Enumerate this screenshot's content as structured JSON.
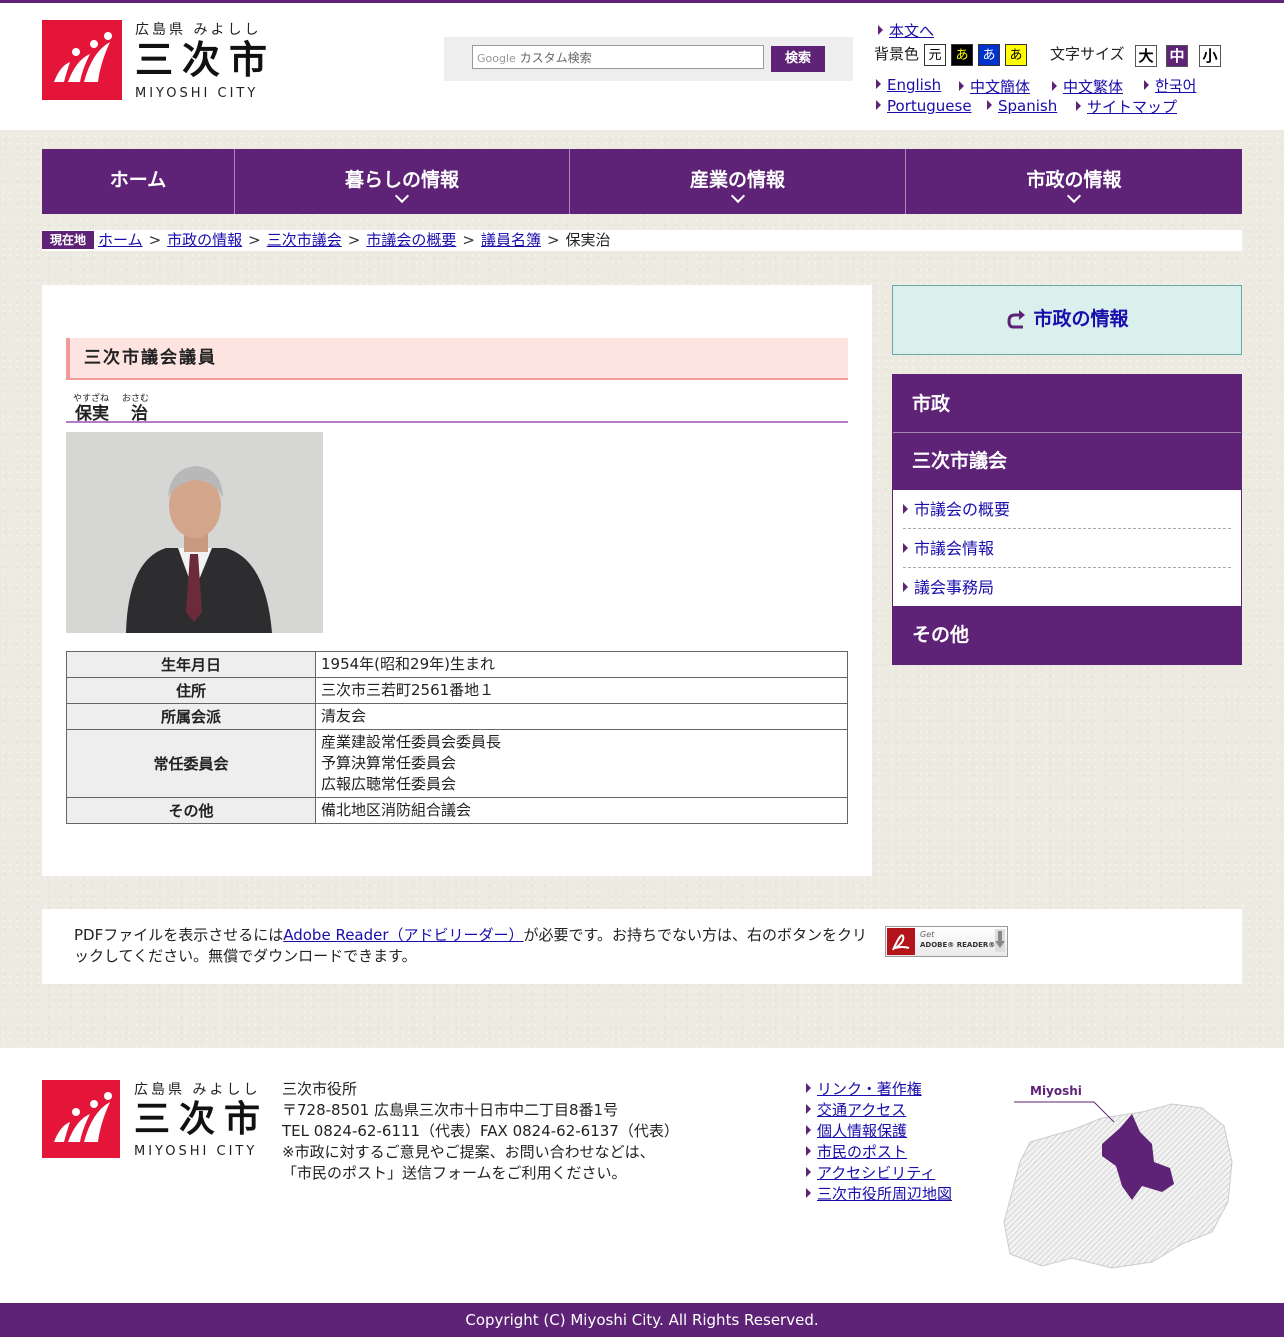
{
  "header": {
    "logo_prefecture": "広島県 みよしし",
    "logo_city": "三次市",
    "logo_en": "MIYOSHI CITY",
    "search_placeholder": "カスタム検索",
    "search_brand": "Google",
    "search_button": "検索",
    "skip_link": "本文へ",
    "bgcolor_label": "背景色",
    "bgcolor_options": [
      "元",
      "あ",
      "あ",
      "あ"
    ],
    "fontsize_label": "文字サイズ",
    "fontsize_options": [
      "大",
      "中",
      "小"
    ],
    "languages": [
      "English",
      "中文簡体",
      "中文繁体",
      "한국어",
      "Portuguese",
      "Spanish",
      "サイトマップ"
    ]
  },
  "nav": [
    "ホーム",
    "暮らしの情報",
    "産業の情報",
    "市政の情報"
  ],
  "breadcrumb": {
    "label": "現在地",
    "items": [
      "ホーム",
      "市政の情報",
      "三次市議会",
      "市議会の概要",
      "議員名簿"
    ],
    "current": "保実治"
  },
  "main": {
    "heading": "三次市議会議員",
    "name_family": "保実",
    "name_given": "治",
    "ruby_family": "やすざね",
    "ruby_given": "おさむ",
    "photo_alt": "保実治議員",
    "table": [
      {
        "label": "生年月日",
        "values": [
          "1954年(昭和29年)生まれ"
        ]
      },
      {
        "label": "住所",
        "values": [
          "三次市三若町2561番地１"
        ]
      },
      {
        "label": "所属会派",
        "values": [
          "清友会"
        ]
      },
      {
        "label": "常任委員会",
        "values": [
          "産業建設常任委員会委員長",
          "予算決算常任委員会",
          "広報広聴常任委員会"
        ]
      },
      {
        "label": "その他",
        "values": [
          "備北地区消防組合議会"
        ]
      }
    ]
  },
  "sidebar": {
    "top_link": "市政の情報",
    "menu": {
      "head1": "市政",
      "head2": "三次市議会",
      "subitems": [
        "市議会の概要",
        "市議会情報",
        "議会事務局"
      ],
      "head3": "その他"
    }
  },
  "pdf": {
    "text_before": "PDFファイルを表示させるには",
    "link": "Adobe Reader（アドビリーダー）",
    "text_after": "が必要です。お持ちでない方は、右のボタンをクリックしてください。無償でダウンロードできます。",
    "badge_top": "Get",
    "badge_bottom": "ADOBE® READER®"
  },
  "footer": {
    "office": "三次市役所",
    "address": "〒728-8501 広島県三次市十日市中二丁目8番1号",
    "tel": "TEL 0824-62-6111（代表）FAX 0824-62-6137（代表）",
    "note1": "※市政に対するご意見やご提案、お問い合わせなどは、",
    "note2": "「市民のポスト」送信フォームをご利用ください。",
    "links": [
      "リンク・著作権",
      "交通アクセス",
      "個人情報保護",
      "市民のポスト",
      "アクセシビリティ",
      "三次市役所周辺地図"
    ],
    "map_label": "Miyoshi",
    "copyright": "Copyright (C) Miyoshi City. All Rights Reserved."
  },
  "colors": {
    "brand_purple": "#5e2376",
    "logo_red": "#e5153a",
    "heading_pink": "#fde4e1",
    "side_teal": "#d9f0ed"
  }
}
